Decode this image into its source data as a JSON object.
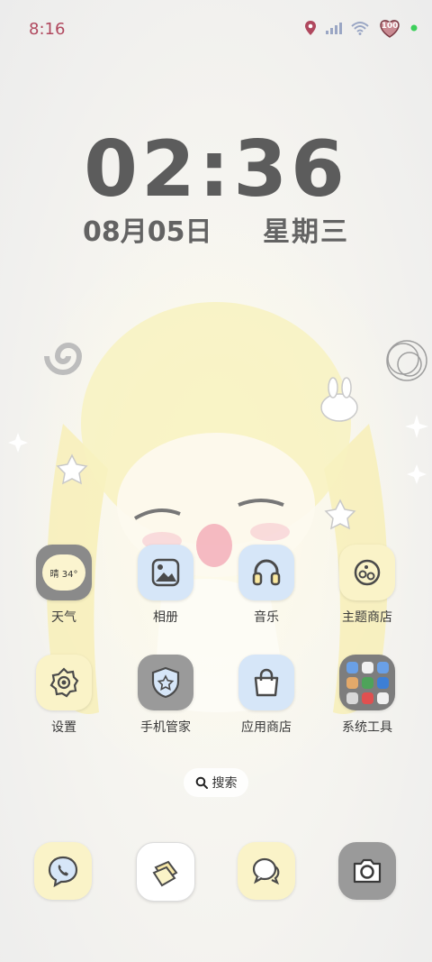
{
  "status_bar": {
    "time": "8:16",
    "battery": "100",
    "icons": [
      "location-pin-icon",
      "signal-icon",
      "wifi-icon",
      "battery-heart-icon",
      "green-dot-icon"
    ]
  },
  "clock": {
    "time": "02:36",
    "date": "08月05日",
    "weekday": "星期三"
  },
  "apps": [
    {
      "label": "天气",
      "icon": "weather-icon",
      "weather_text": "晴 34°"
    },
    {
      "label": "相册",
      "icon": "gallery-icon"
    },
    {
      "label": "音乐",
      "icon": "headphones-icon"
    },
    {
      "label": "主题商店",
      "icon": "theme-store-icon"
    },
    {
      "label": "设置",
      "icon": "settings-icon"
    },
    {
      "label": "手机管家",
      "icon": "phone-manager-icon"
    },
    {
      "label": "应用商店",
      "icon": "app-store-icon"
    },
    {
      "label": "系统工具",
      "icon": "system-tools-folder-icon"
    }
  ],
  "search": {
    "label": "搜索"
  },
  "dock": [
    {
      "icon": "phone-icon"
    },
    {
      "icon": "notes-icon"
    },
    {
      "icon": "messages-icon"
    },
    {
      "icon": "camera-icon"
    }
  ],
  "colors": {
    "status_time": "#b0485e",
    "clock": "#5c5c5c",
    "yellow_icon": "#faf3c8",
    "blue_icon": "#d6e6f8",
    "gray_icon": "#9a9a9a"
  }
}
